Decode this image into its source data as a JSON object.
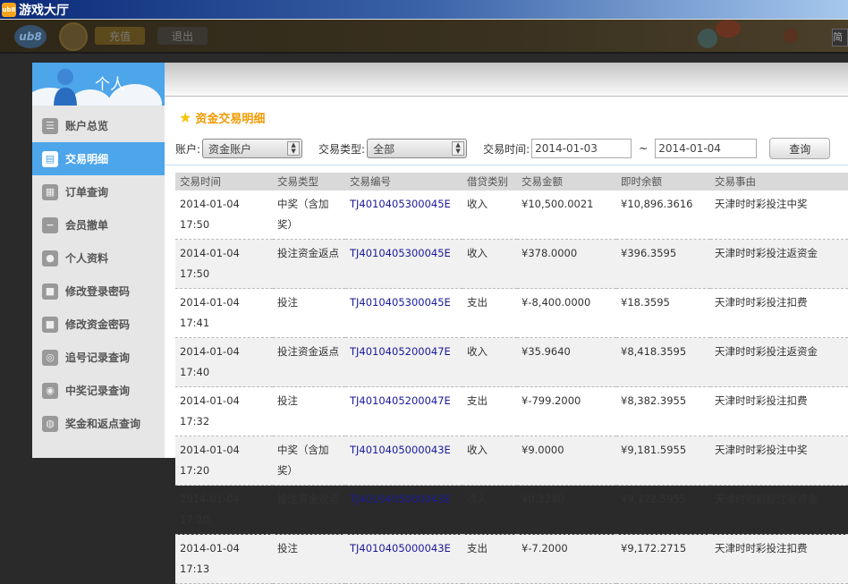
{
  "window": {
    "title": "游戏大厅",
    "icon": "ub8"
  },
  "topbar": {
    "logo": "ub8",
    "charge_label": "充值",
    "logout_label": "退出",
    "right_label": "简"
  },
  "sidebar": {
    "title": "个人",
    "items": [
      {
        "label": "账户总览",
        "icon": "list-icon"
      },
      {
        "label": "交易明细",
        "icon": "document-icon",
        "active": true
      },
      {
        "label": "订单查询",
        "icon": "clipboard-icon"
      },
      {
        "label": "会员撤单",
        "icon": "minus-circle-icon"
      },
      {
        "label": "个人资料",
        "icon": "user-search-icon"
      },
      {
        "label": "修改登录密码",
        "icon": "lock-icon"
      },
      {
        "label": "修改资金密码",
        "icon": "lock-icon"
      },
      {
        "label": "追号记录查询",
        "icon": "search-icon"
      },
      {
        "label": "中奖记录查询",
        "icon": "search-chart-icon"
      },
      {
        "label": "奖金和返点查询",
        "icon": "search-coins-icon"
      }
    ]
  },
  "main": {
    "title": "资金交易明细",
    "filters": {
      "account_label": "账户:",
      "account_value": "资金账户",
      "type_label": "交易类型:",
      "type_value": "全部",
      "time_label": "交易时间:",
      "date_from": "2014-01-03",
      "tilde": "~",
      "date_to": "2014-01-04",
      "query_label": "查询"
    },
    "columns": [
      "交易时间",
      "交易类型",
      "交易编号",
      "借贷类别",
      "交易金额",
      "即时余额",
      "交易事由"
    ],
    "rows": [
      [
        "2014-01-04 17:50",
        "中奖（含加奖）",
        "TJ4010405300045E",
        "收入",
        "¥10,500.0021",
        "¥10,896.3616",
        "天津时时彩投注中奖"
      ],
      [
        "2014-01-04 17:50",
        "投注资金返点",
        "TJ4010405300045E",
        "收入",
        "¥378.0000",
        "¥396.3595",
        "天津时时彩投注返资金"
      ],
      [
        "2014-01-04 17:41",
        "投注",
        "TJ4010405300045E",
        "支出",
        "¥-8,400.0000",
        "¥18.3595",
        "天津时时彩投注扣费"
      ],
      [
        "2014-01-04 17:40",
        "投注资金返点",
        "TJ4010405200047E",
        "收入",
        "¥35.9640",
        "¥8,418.3595",
        "天津时时彩投注返资金"
      ],
      [
        "2014-01-04 17:32",
        "投注",
        "TJ4010405200047E",
        "支出",
        "¥-799.2000",
        "¥8,382.3955",
        "天津时时彩投注扣费"
      ],
      [
        "2014-01-04 17:20",
        "中奖（含加奖）",
        "TJ4010405000043E",
        "收入",
        "¥9.0000",
        "¥9,181.5955",
        "天津时时彩投注中奖"
      ],
      [
        "2014-01-04 17:20",
        "投注资金返点",
        "TJ4010405000043E",
        "收入",
        "¥0.3240",
        "¥9,172.5955",
        "天津时时彩投注返资金"
      ],
      [
        "2014-01-04 17:13",
        "投注",
        "TJ4010405000043E",
        "支出",
        "¥-7.2000",
        "¥9,172.2715",
        "天津时时彩投注扣费"
      ]
    ]
  },
  "colors": {
    "accent": "#4da5ea",
    "title": "#f09a00",
    "link": "#1a1a9a"
  }
}
